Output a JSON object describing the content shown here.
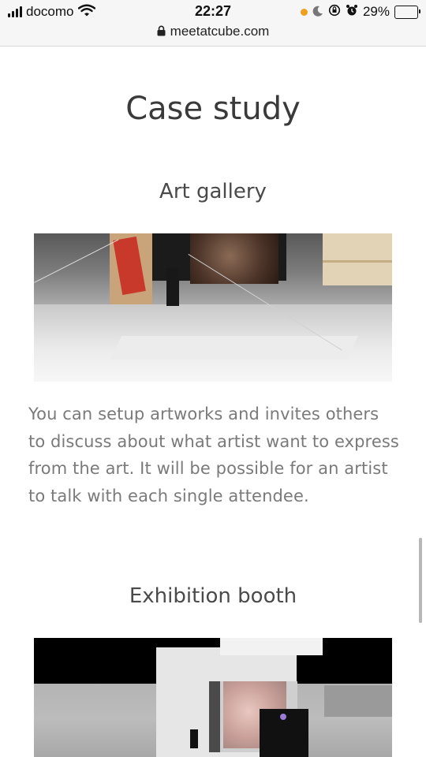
{
  "status_bar": {
    "carrier": "docomo",
    "time": "22:27",
    "battery_percent": "29%",
    "battery_level": 0.29,
    "url": "meetatcube.com",
    "icons": [
      "signal-icon",
      "wifi-icon",
      "orange-dot-icon",
      "moon-icon",
      "rotation-lock-icon",
      "alarm-icon",
      "battery-icon",
      "lock-icon"
    ]
  },
  "page": {
    "title": "Case study"
  },
  "sections": [
    {
      "title": "Art gallery",
      "image_alt": "3D virtual art gallery scene",
      "description": "You can setup artworks and invites others to discuss about what artist want to express from the art. It will be possible for an artist to talk with each single attendee."
    },
    {
      "title": "Exhibition booth",
      "image_alt": "3D virtual exhibition booth scene"
    }
  ],
  "colors": {
    "title_text": "#3a3a3a",
    "body_text": "#7a7a7a",
    "status_bar_bg": "#f6f6f6",
    "status_dot": "#f0a020"
  }
}
